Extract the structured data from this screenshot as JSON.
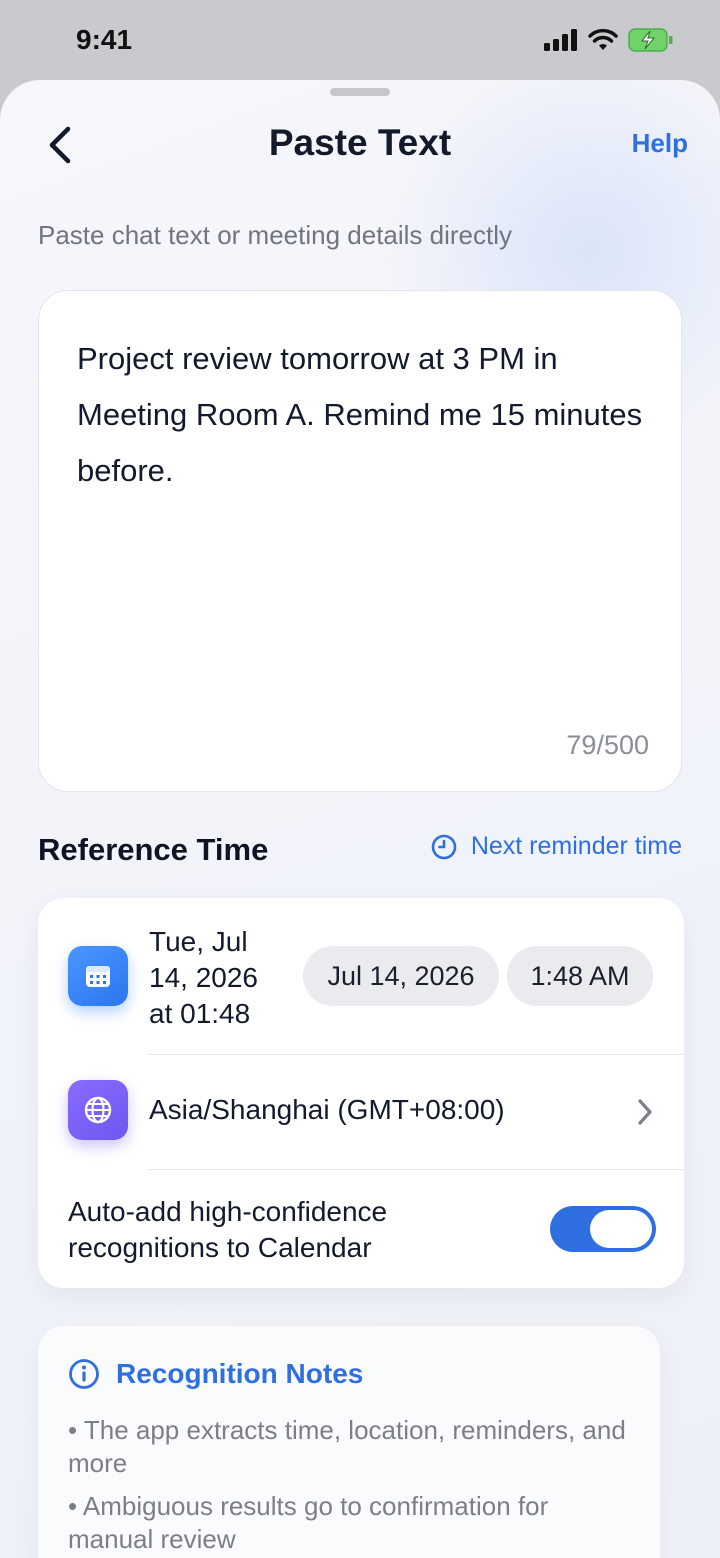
{
  "status": {
    "time": "9:41"
  },
  "header": {
    "title": "Paste Text",
    "help": "Help"
  },
  "subtitle": "Paste chat text or meeting details directly",
  "input": {
    "text": "Project review tomorrow at 3 PM in Meeting Room A. Remind me 15 minutes before.",
    "counter": "79/500"
  },
  "reference": {
    "title": "Reference Time",
    "next_reminder": "Next reminder time",
    "datetime_summary": "Tue, Jul 14, 2026 at 01:48",
    "date_pill": "Jul 14, 2026",
    "time_pill": "1:48 AM",
    "timezone": "Asia/Shanghai (GMT+08:00)",
    "auto_add_label": "Auto-add high-confidence recognitions to Calendar",
    "auto_add_enabled": true
  },
  "notes": {
    "title": "Recognition Notes",
    "items": [
      "• The app extracts time, location, reminders, and more",
      "• Ambiguous results go to confirmation for manual review"
    ]
  },
  "colors": {
    "accent": "#2f6fe0",
    "calendar_icon": "#2b75f0",
    "globe_icon": "#6c58f0"
  }
}
